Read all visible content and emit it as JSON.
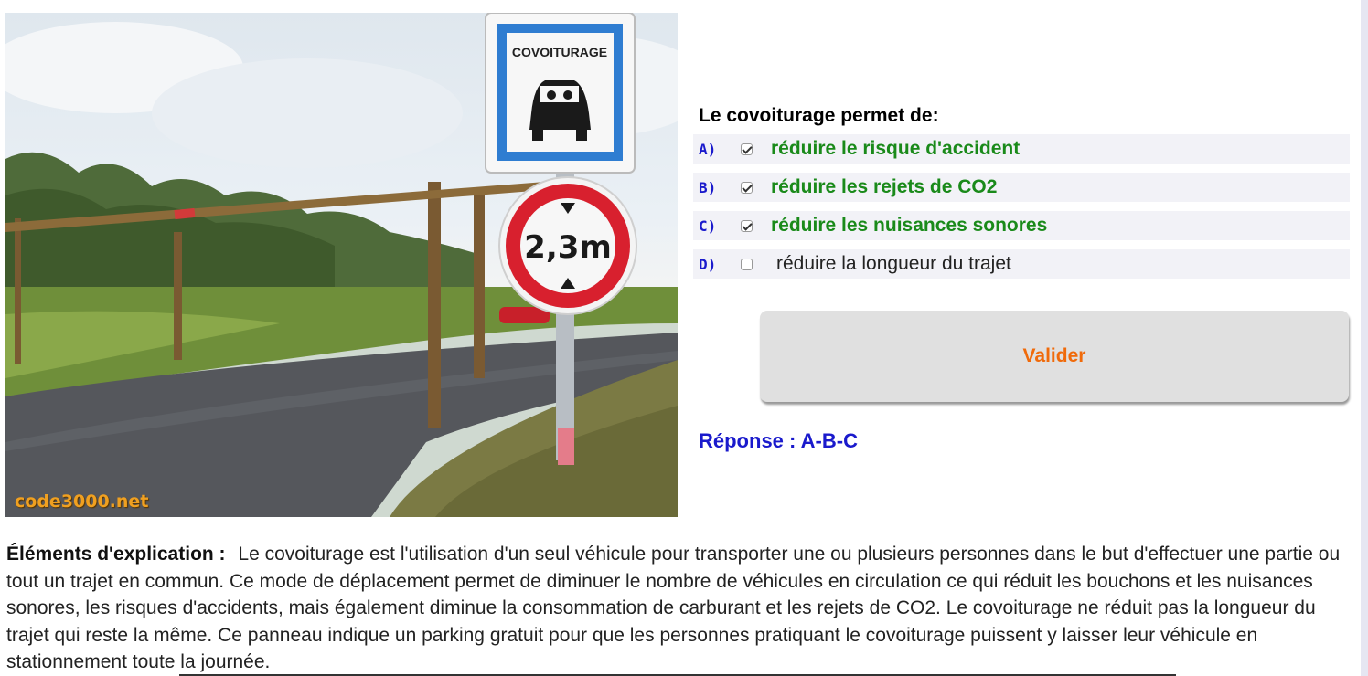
{
  "photo": {
    "watermark": "code3000.net",
    "sign_top_text": "COVOITURAGE",
    "sign_bottom_text": "2,3m"
  },
  "question": {
    "text": "Le covoiturage permet de:",
    "options": [
      {
        "letter": "A)",
        "text": "réduire le risque d'accident",
        "checked": true,
        "correct": true
      },
      {
        "letter": "B)",
        "text": "réduire les rejets de CO2",
        "checked": true,
        "correct": true
      },
      {
        "letter": "C)",
        "text": "réduire les nuisances sonores",
        "checked": true,
        "correct": true
      },
      {
        "letter": "D)",
        "text": "réduire la longueur du trajet",
        "checked": false,
        "correct": false
      }
    ]
  },
  "validate_label": "Valider",
  "answer_text": "Réponse : A-B-C",
  "explanation": {
    "title": "Éléments d'explication :",
    "body": "Le covoiturage est l'utilisation d'un seul véhicule pour transporter une ou plusieurs personnes dans le but d'effectuer une partie ou tout un trajet en commun. Ce mode de déplacement permet de diminuer le nombre de véhicules en circulation ce qui réduit les bouchons et les nuisances sonores, les risques d'accidents, mais également diminue la consommation de carburant et les rejets de CO2. Le covoiturage ne réduit pas la longueur du trajet qui reste la même. Ce panneau indique un parking gratuit pour que les personnes pratiquant le covoiturage puissent y laisser leur véhicule en stationnement toute la journée."
  },
  "colors": {
    "correct": "#1a8a1a",
    "letter": "#1a1acc",
    "validate_text": "#f06a0a",
    "answer": "#1a1acc"
  }
}
